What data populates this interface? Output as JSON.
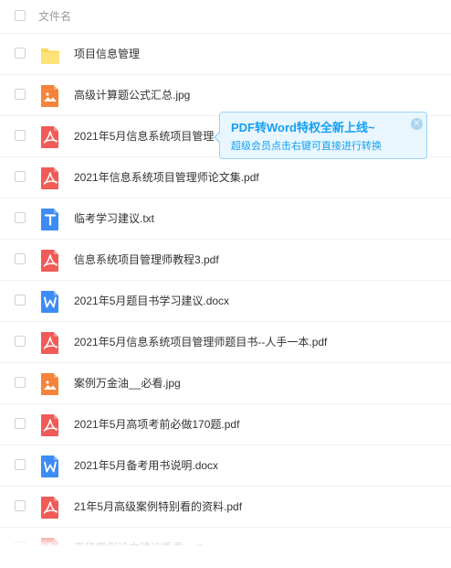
{
  "header": {
    "label": "文件名"
  },
  "files": [
    {
      "name": "项目信息管理",
      "type": "folder"
    },
    {
      "name": "高级计算题公式汇总.jpg",
      "type": "image"
    },
    {
      "name": "2021年5月信息系统项目管理",
      "type": "pdf"
    },
    {
      "name": "2021年信息系统项目管理师论文集.pdf",
      "type": "pdf"
    },
    {
      "name": "临考学习建议.txt",
      "type": "txt"
    },
    {
      "name": "信息系统项目管理师教程3.pdf",
      "type": "pdf"
    },
    {
      "name": "2021年5月题目书学习建议.docx",
      "type": "docx"
    },
    {
      "name": "2021年5月信息系统项目管理师题目书--人手一本.pdf",
      "type": "pdf"
    },
    {
      "name": "案例万金油__必看.jpg",
      "type": "image"
    },
    {
      "name": "2021年5月高项考前必做170题.pdf",
      "type": "pdf"
    },
    {
      "name": "2021年5月备考用书说明.docx",
      "type": "docx"
    },
    {
      "name": "21年5月高级案例特别看的资料.pdf",
      "type": "pdf"
    },
    {
      "name": "高级案例论文建议看看.pdf",
      "type": "pdf"
    }
  ],
  "tooltip": {
    "title": "PDF转Word特权全新上线~",
    "subtitle": "超级会员点击右键可直接进行转换",
    "close_symbol": "×"
  },
  "colors": {
    "folder": "#fdd75a",
    "image": "#f5843a",
    "pdf": "#f15b57",
    "txt": "#3d8cf6",
    "docx": "#3d8cf6",
    "accent": "#14a0f2"
  }
}
